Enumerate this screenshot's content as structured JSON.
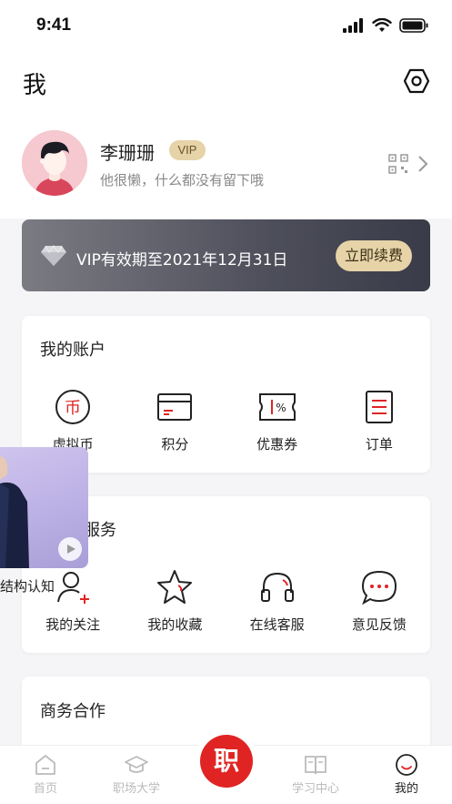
{
  "status_bar": {
    "time": "9:41"
  },
  "header": {
    "title": "我"
  },
  "profile": {
    "name": "李珊珊",
    "vip_badge": "VIP",
    "bio": "他很懒，什么都没有留下哦"
  },
  "vip_card": {
    "text": "VIP有效期至2021年12月31日",
    "renew_label": "立即续费"
  },
  "account": {
    "title": "我的账户",
    "items": [
      {
        "label": "虚拟币",
        "icon": "coin-icon"
      },
      {
        "label": "积分",
        "icon": "card-icon"
      },
      {
        "label": "优惠券",
        "icon": "coupon-icon"
      },
      {
        "label": "订单",
        "icon": "order-icon"
      }
    ]
  },
  "services": {
    "title_visible": "服务",
    "items": [
      {
        "label": "我的关注",
        "icon": "follow-icon"
      },
      {
        "label": "我的收藏",
        "icon": "star-icon"
      },
      {
        "label": "在线客服",
        "icon": "headset-icon"
      },
      {
        "label": "意见反馈",
        "icon": "feedback-icon"
      }
    ]
  },
  "business": {
    "title": "商务合作"
  },
  "float_video": {
    "caption": "结构认知"
  },
  "tab_bar": {
    "items": [
      {
        "label": "首页",
        "icon": "home-icon",
        "active": false
      },
      {
        "label": "职场大学",
        "icon": "graduation-icon",
        "active": false
      },
      {
        "label": "职",
        "icon": "center-icon",
        "active": false
      },
      {
        "label": "学习中心",
        "icon": "book-icon",
        "active": false
      },
      {
        "label": "我的",
        "icon": "profile-icon",
        "active": true
      }
    ]
  },
  "colors": {
    "brand_red": "#e02424",
    "gold": "#e6d3a8",
    "vip_dark": "#3a3b48"
  }
}
